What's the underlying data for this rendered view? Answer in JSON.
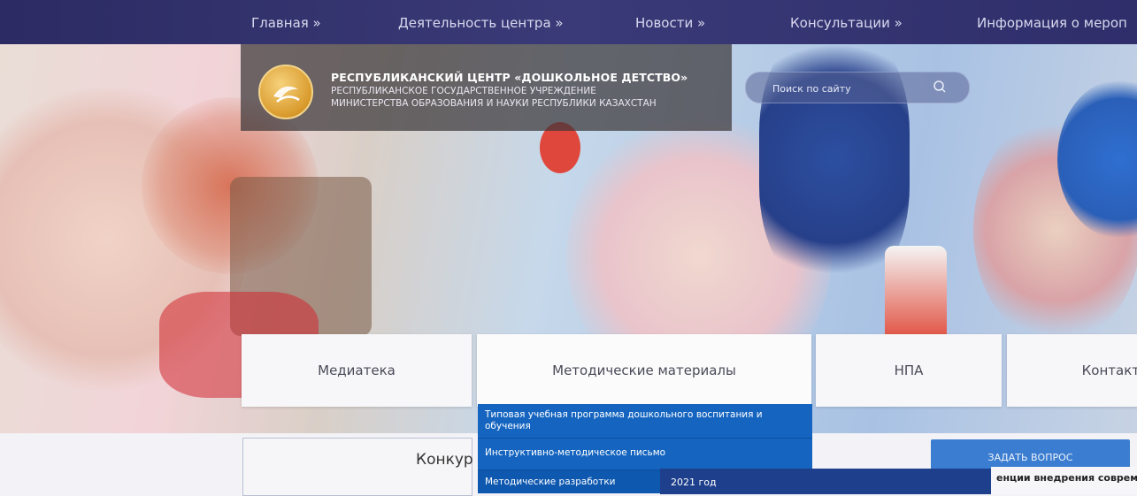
{
  "nav": {
    "items": [
      "Главная »",
      "Деятельность центра »",
      "Новости »",
      "Консультации »",
      "Информация о мероп"
    ]
  },
  "header": {
    "title": "РЕСПУБЛИКАНСКИЙ ЦЕНТР «ДОШКОЛЬНОЕ ДЕТСТВО»",
    "subtitle_1": "РЕСПУБЛИКАНСКОЕ ГОСУДАРСТВЕННОЕ УЧРЕЖДЕНИЕ",
    "subtitle_2": "МИНИСТЕРСТВА ОБРАЗОВАНИЯ И НАУКИ РЕСПУБЛИКИ КАЗАХСТАН"
  },
  "search": {
    "placeholder": "Поиск по сайту"
  },
  "tiles": [
    "Медиатека",
    "Методические материалы",
    "НПА",
    "Контакт"
  ],
  "dropdown": {
    "items": [
      "Типовая учебная программа дошкольного воспитания и обучения",
      "Инструктивно-методическое письмо",
      "Методические разработки"
    ],
    "submenu_item": "2021 год"
  },
  "main": {
    "section_title": "Конкур"
  },
  "sidebar": {
    "ask_button": "ЗАДАТЬ ВОПРОС",
    "partial_text": "енции внедрения соврем"
  },
  "colors": {
    "nav_bg": "#2c2b63",
    "dropdown_bg": "#1565c0",
    "ask_button": "#3b7dd0"
  }
}
